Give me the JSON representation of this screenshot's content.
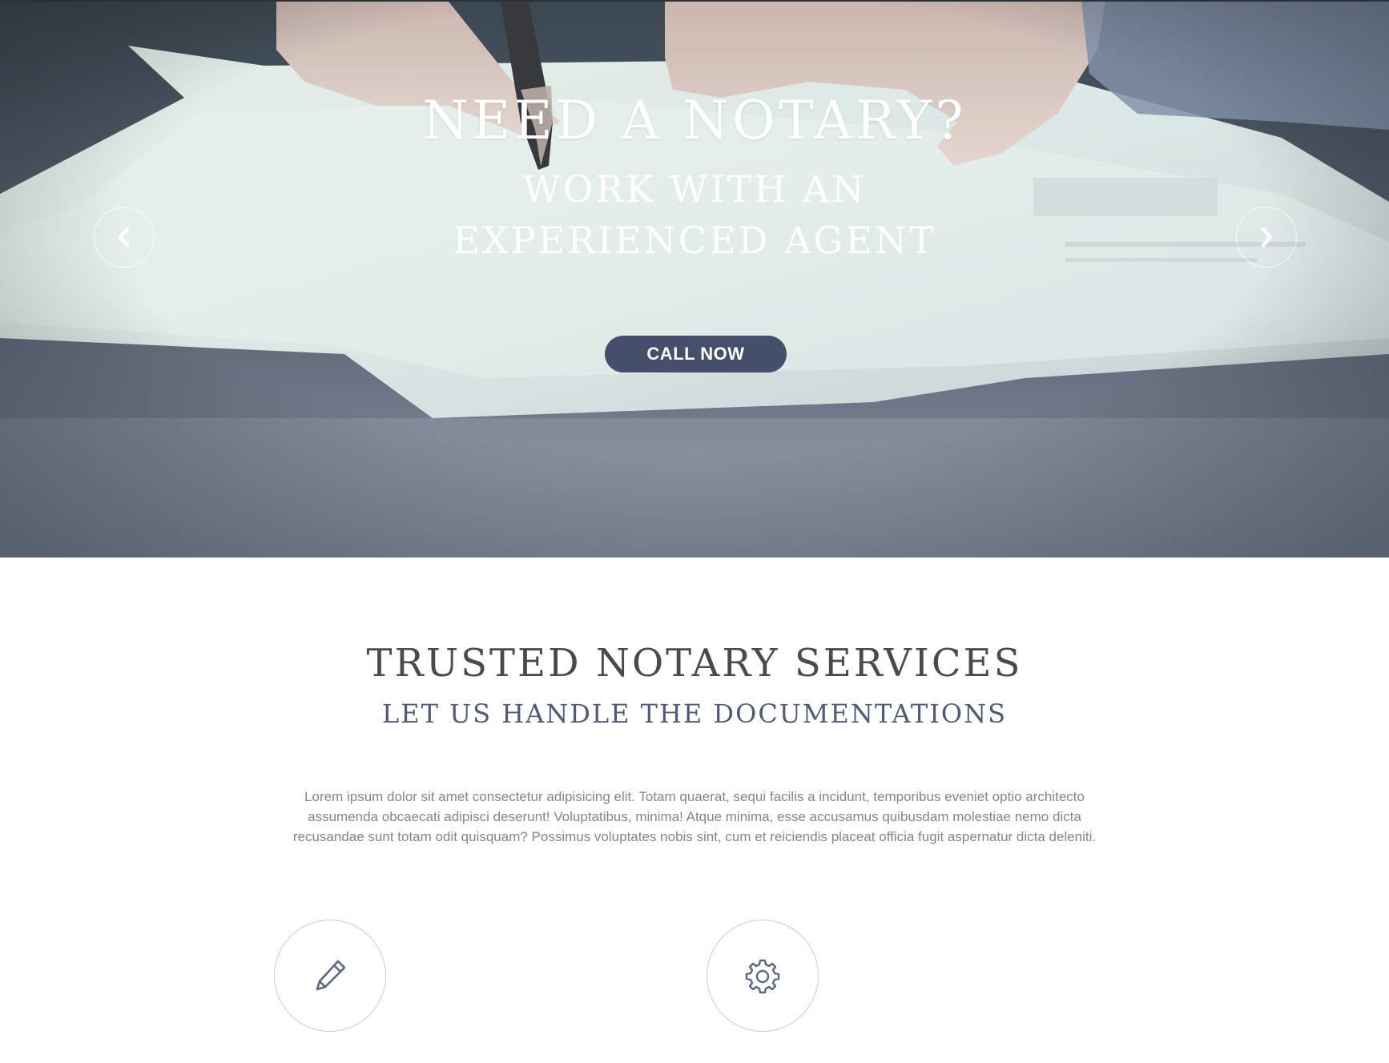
{
  "hero": {
    "title": "NEED A NOTARY?",
    "subtitle": "WORK WITH AN EXPERIENCED AGENT",
    "cta_label": "CALL NOW",
    "prev_icon": "chevron-left-icon",
    "next_icon": "chevron-right-icon"
  },
  "services": {
    "title": "TRUSTED NOTARY SERVICES",
    "subtitle": "LET US HANDLE THE DOCUMENTATIONS",
    "body": "Lorem ipsum dolor sit amet consectetur adipisicing elit. Totam quaerat, sequi facilis a incidunt, temporibus eveniet optio architecto assumenda obcaecati adipisci deserunt! Voluptatibus, minima! Atque minima, esse accusamus quibusdam molestiae nemo dicta recusandae sunt totam odit quisquam? Possimus voluptates nobis sint, cum et reiciendis placeat officia fugit aspernatur dicta deleniti.",
    "features": [
      {
        "icon": "pencil-icon"
      },
      {
        "icon": "gear-icon"
      }
    ]
  },
  "colors": {
    "accent": "#454f6c",
    "subtitle": "#4f5a78",
    "body_text": "#858585",
    "title_text": "#4a4a4a"
  }
}
